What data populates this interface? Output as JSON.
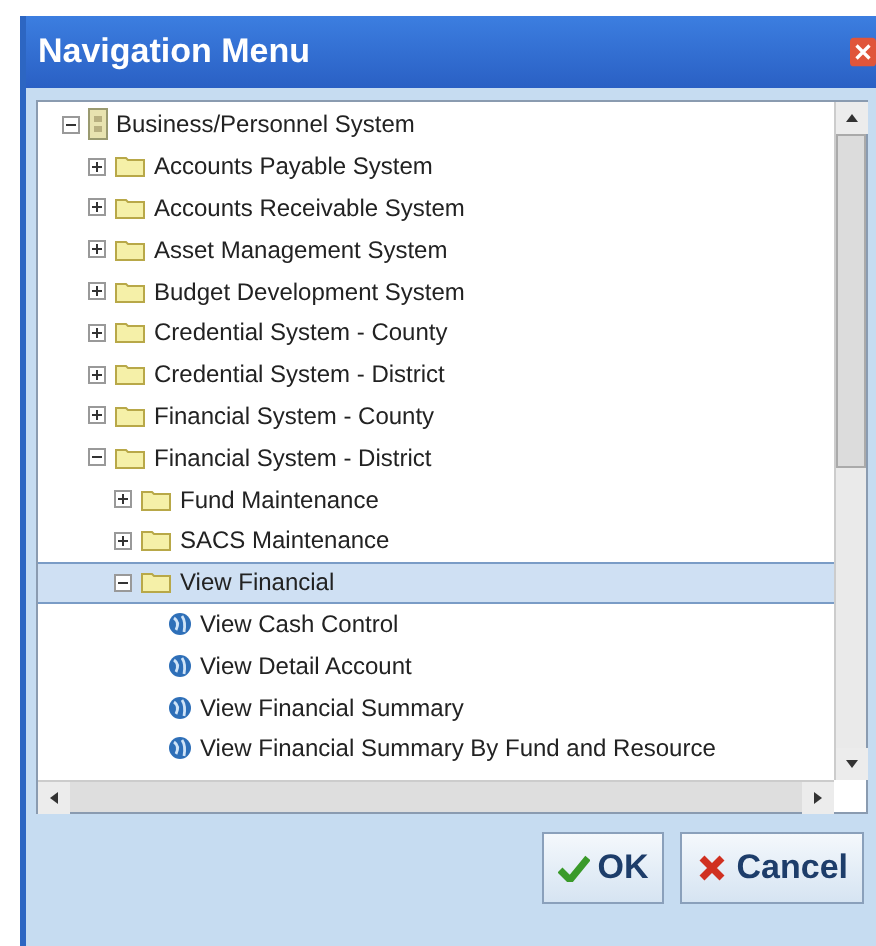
{
  "window": {
    "title": "Navigation Menu"
  },
  "tree": [
    {
      "label": "Business/Personnel System",
      "kind": "root",
      "expanded": true,
      "selected": false,
      "children": [
        {
          "label": "Accounts Payable System",
          "kind": "folder",
          "expanded": false,
          "selected": false
        },
        {
          "label": "Accounts Receivable System",
          "kind": "folder",
          "expanded": false,
          "selected": false
        },
        {
          "label": "Asset Management System",
          "kind": "folder",
          "expanded": false,
          "selected": false
        },
        {
          "label": "Budget Development System",
          "kind": "folder",
          "expanded": false,
          "selected": false
        },
        {
          "label": "Credential System - County",
          "kind": "folder",
          "expanded": false,
          "selected": false
        },
        {
          "label": "Credential System - District",
          "kind": "folder",
          "expanded": false,
          "selected": false
        },
        {
          "label": "Financial System - County",
          "kind": "folder",
          "expanded": false,
          "selected": false
        },
        {
          "label": "Financial System - District",
          "kind": "folder",
          "expanded": true,
          "selected": false,
          "children": [
            {
              "label": "Fund Maintenance",
              "kind": "folder",
              "expanded": false,
              "selected": false
            },
            {
              "label": "SACS Maintenance",
              "kind": "folder",
              "expanded": false,
              "selected": false
            },
            {
              "label": "View Financial",
              "kind": "folder",
              "expanded": true,
              "selected": true,
              "children": [
                {
                  "label": "View Cash Control",
                  "kind": "report",
                  "selected": false
                },
                {
                  "label": "View Detail Account",
                  "kind": "report",
                  "selected": false
                },
                {
                  "label": "View Financial Summary",
                  "kind": "report",
                  "selected": false
                },
                {
                  "label": "View Financial Summary By Fund and Resource",
                  "kind": "report",
                  "selected": false
                }
              ]
            }
          ]
        }
      ]
    }
  ],
  "buttons": [
    {
      "label": "OK",
      "kind": "ok"
    },
    {
      "label": "Cancel",
      "kind": "cancel"
    }
  ]
}
